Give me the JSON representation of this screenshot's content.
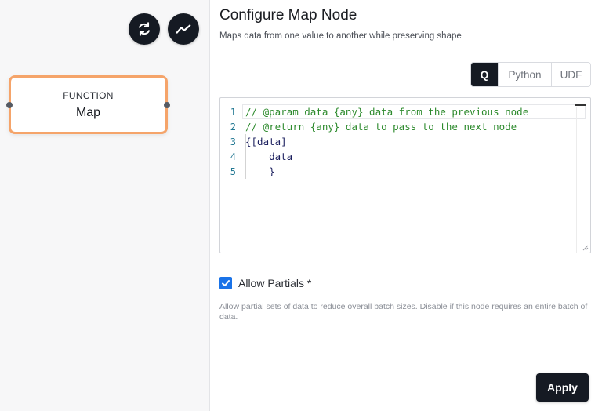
{
  "canvas": {
    "actions": [
      {
        "icon": "refresh-icon"
      },
      {
        "icon": "line-chart-icon"
      }
    ],
    "node": {
      "type_label": "FUNCTION",
      "name": "Map",
      "border_color": "#f5a46a"
    }
  },
  "panel": {
    "title": "Configure Map Node",
    "subtitle": "Maps data from one value to another while preserving shape",
    "languages": {
      "options": [
        "Q",
        "Python",
        "UDF"
      ],
      "selected": "Q"
    },
    "editor": {
      "lines": [
        {
          "number": "1",
          "text": "// @param data {any} data from the previous node"
        },
        {
          "number": "2",
          "text": "// @return {any} data to pass to the next node"
        },
        {
          "number": "3",
          "text": "{[data]"
        },
        {
          "number": "4",
          "text": "    data"
        },
        {
          "number": "5",
          "text": "    }"
        }
      ]
    },
    "allow_partials": {
      "label": "Allow Partials *",
      "checked": true,
      "helper": "Allow partial sets of data to reduce overall batch sizes. Disable if this node requires an entire batch of data."
    },
    "apply_label": "Apply"
  },
  "colors": {
    "primary_dark": "#151a23",
    "checkbox_blue": "#1a73e8",
    "comment_green": "#2e8b2e",
    "line_number": "#237893"
  }
}
